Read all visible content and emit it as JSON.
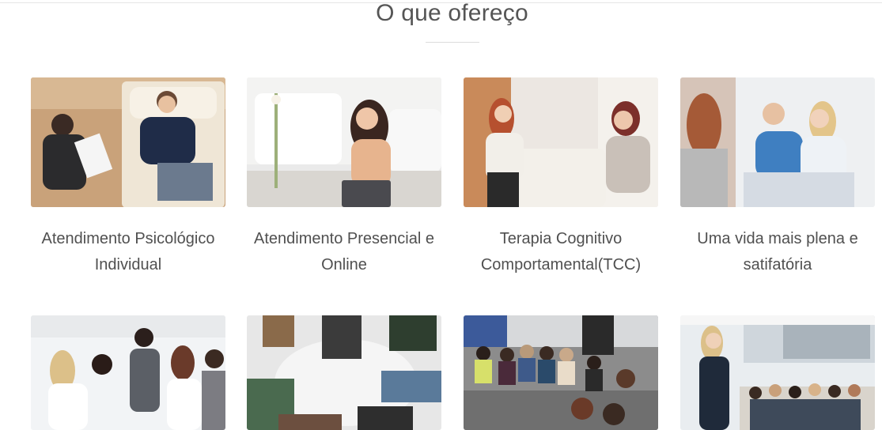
{
  "section": {
    "title": "O que ofereço"
  },
  "cards": [
    {
      "title": "Atendimento Psicológico Individual",
      "image": "therapist-and-client-session-photo"
    },
    {
      "title": "Atendimento Presencial e Online",
      "image": "woman-at-laptop-photo"
    },
    {
      "title": "Terapia Cognitivo Comportamental(TCC)",
      "image": "cbt-session-photo"
    },
    {
      "title": "Uma vida mais plena e satifatória",
      "image": "happy-couple-photo"
    },
    {
      "title": "",
      "image": "group-therapy-standing-photo"
    },
    {
      "title": "",
      "image": "group-circle-top-view-photo"
    },
    {
      "title": "",
      "image": "audience-circle-photo"
    },
    {
      "title": "",
      "image": "speaker-presentation-photo"
    }
  ]
}
